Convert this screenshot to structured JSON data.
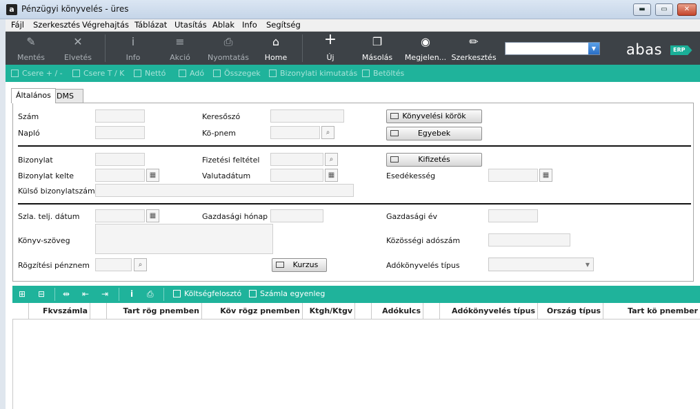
{
  "window": {
    "title": "Pénzügyi könyvelés - üres",
    "app_icon": "a",
    "minimize": "▬",
    "maximize": "▭",
    "close": "✕"
  },
  "menu": [
    "Fájl",
    "Szerkesztés",
    "Végrehajtás",
    "Táblázat",
    "Utasítás",
    "Ablak",
    "Info",
    "Segítség"
  ],
  "toolbar": {
    "buttons": [
      {
        "label": "Mentés",
        "icon": "save-icon",
        "glyph": "✎"
      },
      {
        "label": "Elvetés",
        "icon": "discard-icon",
        "glyph": "✕"
      },
      {
        "label": "Info",
        "icon": "info-icon",
        "glyph": "i"
      },
      {
        "label": "Akció",
        "icon": "menu-icon",
        "glyph": "≡"
      },
      {
        "label": "Nyomtatás",
        "icon": "print-icon",
        "glyph": "⎙"
      },
      {
        "label": "Home",
        "icon": "home-icon",
        "glyph": "⌂"
      },
      {
        "label": "Új",
        "icon": "plus-icon",
        "glyph": "+"
      },
      {
        "label": "Másolás",
        "icon": "copy-icon",
        "glyph": "❐"
      },
      {
        "label": "Megjelen...",
        "icon": "eye-icon",
        "glyph": "◉"
      },
      {
        "label": "Szerkesztés",
        "icon": "pencil-icon",
        "glyph": "✏"
      }
    ],
    "search_value": "",
    "dropdown_glyph": "▼",
    "logo_word": "abas",
    "logo_badge": "ERP"
  },
  "actions": [
    "Csere + / -",
    "Csere T / K",
    "Nettó",
    "Adó",
    "Összegek",
    "Bizonylati kimutatás",
    "Betöltés"
  ],
  "tabs": [
    "Általános",
    "DMS"
  ],
  "form": {
    "szam": "Szám",
    "naplo": "Napló",
    "keresoszo": "Keresőszó",
    "kopnem": "Kö-pnem",
    "btn_konyvelesi_korok": "Könyvelési körök",
    "btn_egyebek": "Egyebek",
    "bizonylat": "Bizonylat",
    "bizonylat_kelte": "Bizonylat kelte",
    "kulso_bizonylatszam": "Külső bizonylatszám",
    "fizetesi_feltetel": "Fizetési feltétel",
    "valutadatum": "Valutadátum",
    "btn_kifizetes": "Kifizetés",
    "esedekesseg": "Esedékesség",
    "szla_telj_datum": "Szla. telj. dátum",
    "gazdasagi_honap": "Gazdasági hónap",
    "gazdasagi_ev": "Gazdasági év",
    "konyv_szoveg": "Könyv-szöveg",
    "kozossegi_adoszam": "Közösségi adószám",
    "rogzitesi_penznem": "Rögzítési pénznem",
    "btn_kurzus": "Kurzus",
    "adokonyveles_tipus": "Adókönyvelés típus",
    "calendar_glyph": "▦",
    "search_glyph": "⌕",
    "select_arrow": "▼"
  },
  "grid": {
    "tool_icons": [
      "⊞",
      "⊟",
      "⇹",
      "⇤",
      "⇥",
      "i",
      "⎙"
    ],
    "links": [
      "Költségfelosztó",
      "Számla egyenleg"
    ],
    "columns": [
      "",
      "Fkvszámla",
      "",
      "Tart rög pnemben",
      "Köv rögz pnemben",
      "Ktgh/Ktgv",
      "",
      "Adókulcs",
      "",
      "Adókönyvelés típus",
      "Ország típus",
      "Tart kö pnember"
    ]
  }
}
